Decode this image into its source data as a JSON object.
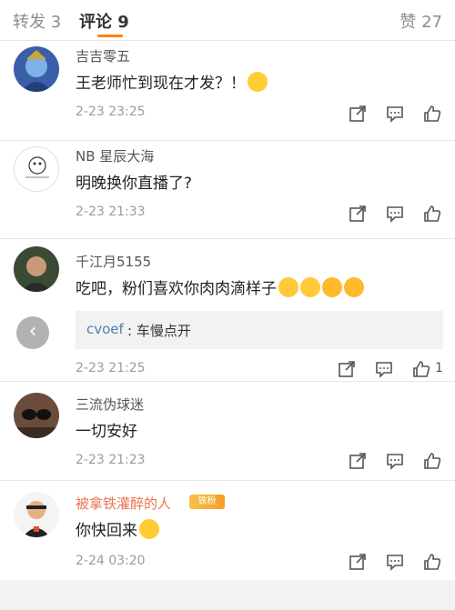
{
  "tabs": {
    "repost": "转发 3",
    "comments": "评论 9",
    "likes": "赞 27"
  },
  "comments": [
    {
      "user": "吉吉零五",
      "text": "王老师忙到现在才发？！",
      "emojis": [
        "grin-emoji"
      ],
      "time": "2-23 23:25",
      "likes": ""
    },
    {
      "user": "NB 星辰大海",
      "text": "明晚换你直播了?",
      "emojis": [],
      "time": "2-23 21:33",
      "likes": ""
    },
    {
      "user": "千江月5155",
      "text": "吃吧，粉们喜欢你肉肉滴样子",
      "emojis": [
        "kiss-emoji",
        "kiss-emoji",
        "tongue-emoji",
        "tongue-emoji"
      ],
      "time": "2-23 21:25",
      "likes": "1",
      "reply": {
        "user": "cvoef",
        "text": ": 车慢点开"
      }
    },
    {
      "user": "三流伪球迷",
      "text": "一切安好",
      "emojis": [],
      "time": "2-23 21:23",
      "likes": ""
    },
    {
      "user": "被拿铁灌醉的人",
      "badge": "铁粉",
      "text": "你快回来",
      "emojis": [
        "laugh-cry-emoji"
      ],
      "time": "2-24 03:20",
      "likes": ""
    }
  ],
  "colors": {
    "accent": "#ff8200",
    "vip_name": "#eb7350",
    "reply_user": "#507daf"
  }
}
